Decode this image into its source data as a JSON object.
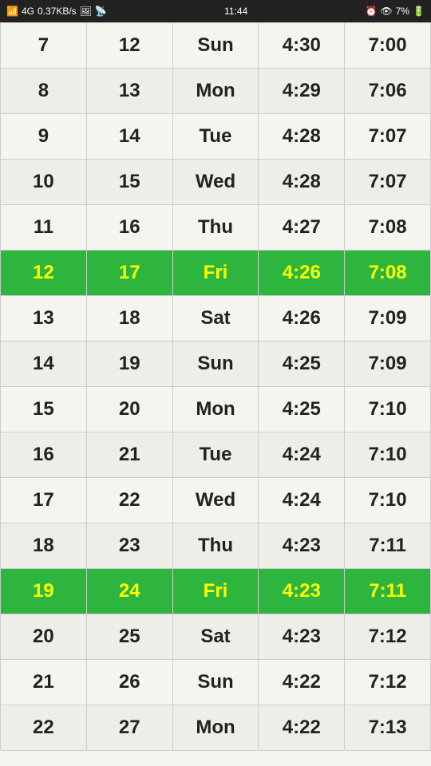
{
  "statusBar": {
    "signal": "📶",
    "network": "4G",
    "speed": "0.37KB/s",
    "time": "11:44",
    "alarm": "🔔",
    "eye": "👁",
    "battery": "7%"
  },
  "rows": [
    {
      "col1": "7",
      "col2": "12",
      "col3": "Sun",
      "col4": "4:30",
      "col5": "7:00",
      "highlight": false
    },
    {
      "col1": "8",
      "col2": "13",
      "col3": "Mon",
      "col4": "4:29",
      "col5": "7:06",
      "highlight": false
    },
    {
      "col1": "9",
      "col2": "14",
      "col3": "Tue",
      "col4": "4:28",
      "col5": "7:07",
      "highlight": false
    },
    {
      "col1": "10",
      "col2": "15",
      "col3": "Wed",
      "col4": "4:28",
      "col5": "7:07",
      "highlight": false
    },
    {
      "col1": "11",
      "col2": "16",
      "col3": "Thu",
      "col4": "4:27",
      "col5": "7:08",
      "highlight": false
    },
    {
      "col1": "12",
      "col2": "17",
      "col3": "Fri",
      "col4": "4:26",
      "col5": "7:08",
      "highlight": true
    },
    {
      "col1": "13",
      "col2": "18",
      "col3": "Sat",
      "col4": "4:26",
      "col5": "7:09",
      "highlight": false
    },
    {
      "col1": "14",
      "col2": "19",
      "col3": "Sun",
      "col4": "4:25",
      "col5": "7:09",
      "highlight": false
    },
    {
      "col1": "15",
      "col2": "20",
      "col3": "Mon",
      "col4": "4:25",
      "col5": "7:10",
      "highlight": false
    },
    {
      "col1": "16",
      "col2": "21",
      "col3": "Tue",
      "col4": "4:24",
      "col5": "7:10",
      "highlight": false
    },
    {
      "col1": "17",
      "col2": "22",
      "col3": "Wed",
      "col4": "4:24",
      "col5": "7:10",
      "highlight": false
    },
    {
      "col1": "18",
      "col2": "23",
      "col3": "Thu",
      "col4": "4:23",
      "col5": "7:11",
      "highlight": false
    },
    {
      "col1": "19",
      "col2": "24",
      "col3": "Fri",
      "col4": "4:23",
      "col5": "7:11",
      "highlight": true
    },
    {
      "col1": "20",
      "col2": "25",
      "col3": "Sat",
      "col4": "4:23",
      "col5": "7:12",
      "highlight": false
    },
    {
      "col1": "21",
      "col2": "26",
      "col3": "Sun",
      "col4": "4:22",
      "col5": "7:12",
      "highlight": false
    },
    {
      "col1": "22",
      "col2": "27",
      "col3": "Mon",
      "col4": "4:22",
      "col5": "7:13",
      "highlight": false
    }
  ]
}
